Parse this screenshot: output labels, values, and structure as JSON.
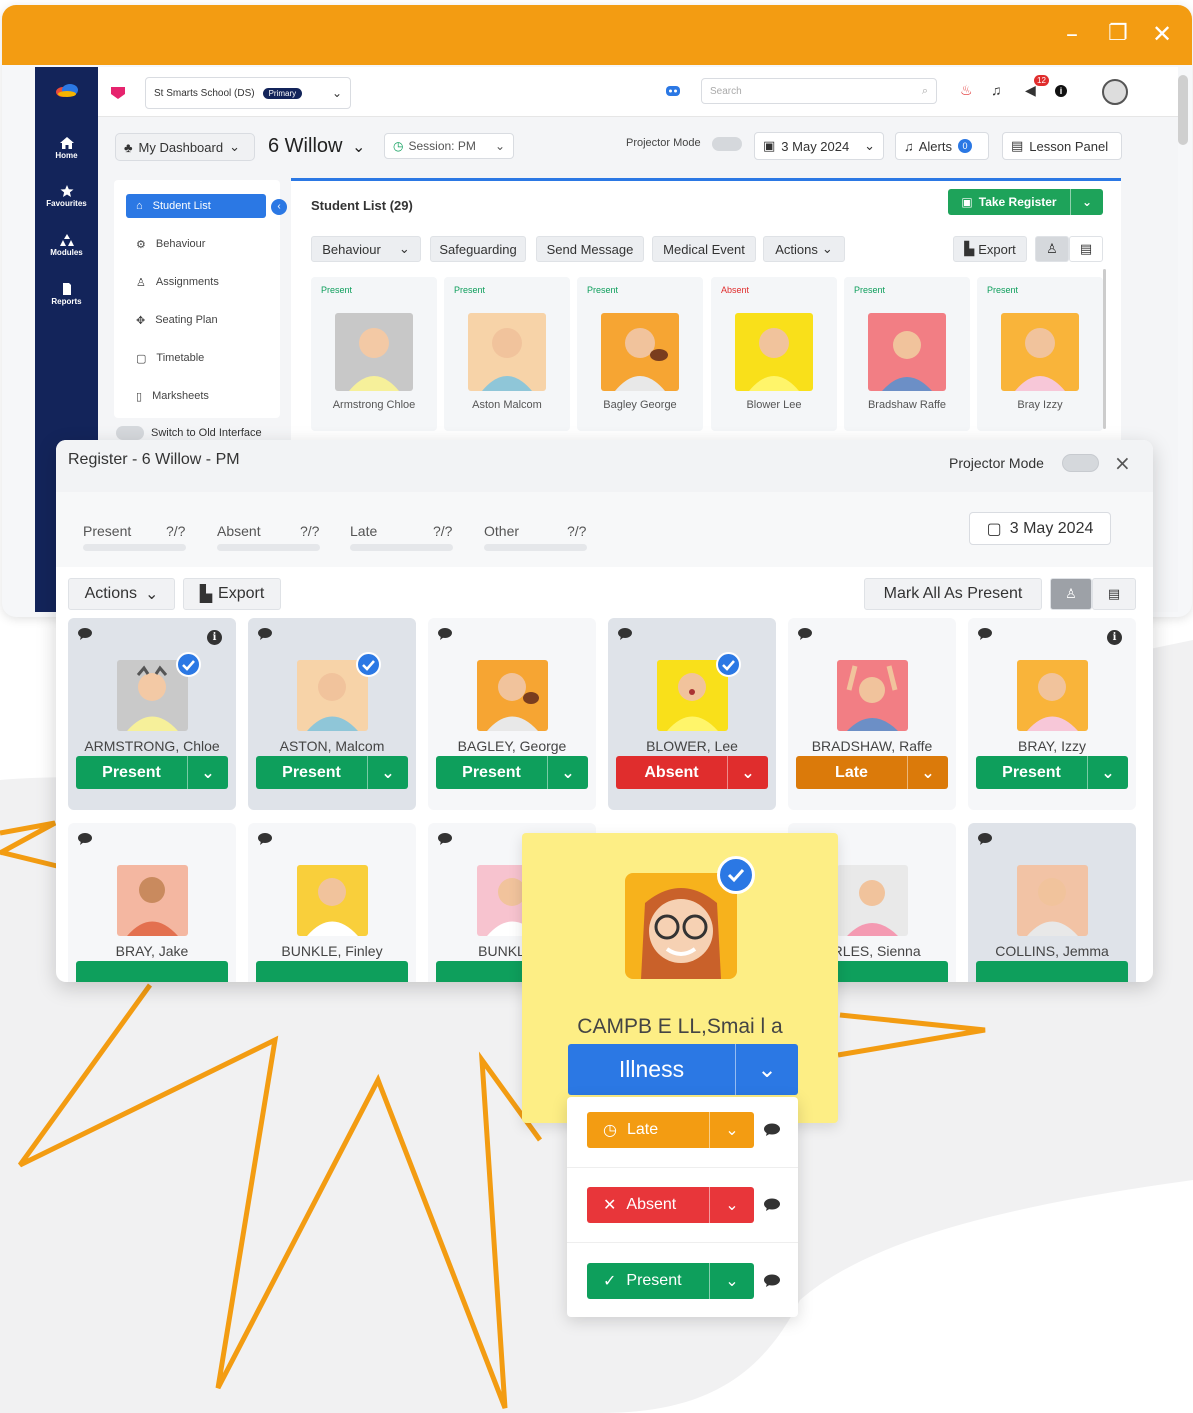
{
  "window": {
    "controls": [
      "–",
      "❐",
      "✕"
    ]
  },
  "rail": {
    "items": [
      "Home",
      "Favourites",
      "Modules",
      "Reports"
    ]
  },
  "topbar": {
    "school": "St Smarts School (DS)",
    "phase_badge": "Primary",
    "search_placeholder": "Search",
    "notification_count": "12"
  },
  "toolbar": {
    "dashboard": "My Dashboard",
    "class_name": "6 Willow",
    "session": "Session: PM",
    "projector_mode": "Projector Mode",
    "date": "3 May 2024",
    "alerts": "Alerts",
    "alerts_count": "0",
    "lesson_panel": "Lesson Panel"
  },
  "menu": {
    "items": [
      "Student List",
      "Behaviour",
      "Assignments",
      "Seating Plan",
      "Timetable",
      "Marksheets"
    ],
    "switch_label": "Switch to Old Interface"
  },
  "student_list": {
    "title": "Student List (29)",
    "take_register": "Take Register",
    "actions": [
      "Behaviour",
      "Safeguarding",
      "Send Message",
      "Medical Event",
      "Actions"
    ],
    "export": "Export",
    "cards": [
      {
        "status": "Present",
        "name": "Armstrong Chloe"
      },
      {
        "status": "Present",
        "name": "Aston Malcom"
      },
      {
        "status": "Present",
        "name": "Bagley George"
      },
      {
        "status": "Absent",
        "name": "Blower Lee"
      },
      {
        "status": "Present",
        "name": "Bradshaw Raffe"
      },
      {
        "status": "Present",
        "name": "Bray Izzy"
      }
    ]
  },
  "register": {
    "title": "Register - 6 Willow - PM",
    "projector_mode": "Projector Mode",
    "stats": [
      {
        "label": "Present",
        "value": "?/?"
      },
      {
        "label": "Absent",
        "value": "?/?"
      },
      {
        "label": "Late",
        "value": "?/?"
      },
      {
        "label": "Other",
        "value": "?/?"
      }
    ],
    "date": "3 May 2024",
    "actions": "Actions",
    "export": "Export",
    "mark_all": "Mark All As Present",
    "row1": [
      {
        "name": "ARMSTRONG, Chloe",
        "status": "Present",
        "color": "#0e9f5c"
      },
      {
        "name": "ASTON, Malcom",
        "status": "Present",
        "color": "#0e9f5c"
      },
      {
        "name": "BAGLEY, George",
        "status": "Present",
        "color": "#0e9f5c"
      },
      {
        "name": "BLOWER, Lee",
        "status": "Absent",
        "color": "#e02d2d"
      },
      {
        "name": "BRADSHAW, Raffe",
        "status": "Late",
        "color": "#db7a0a"
      },
      {
        "name": "BRAY, Izzy",
        "status": "Present",
        "color": "#0e9f5c"
      }
    ],
    "row2": [
      {
        "name": "BRAY, Jake"
      },
      {
        "name": "BUNKLE, Finley"
      },
      {
        "name": "BUNKLE, I"
      },
      {
        "name": "ARLES, Sienna"
      },
      {
        "name": "COLLINS, Jemma"
      }
    ]
  },
  "popup": {
    "name": "CAMPB E LL,Smai l a",
    "status": "Illness",
    "options": [
      {
        "label": "Late",
        "color": "#f39c12"
      },
      {
        "label": "Absent",
        "color": "#e8363a"
      },
      {
        "label": "Present",
        "color": "#0e9f5c"
      }
    ]
  }
}
